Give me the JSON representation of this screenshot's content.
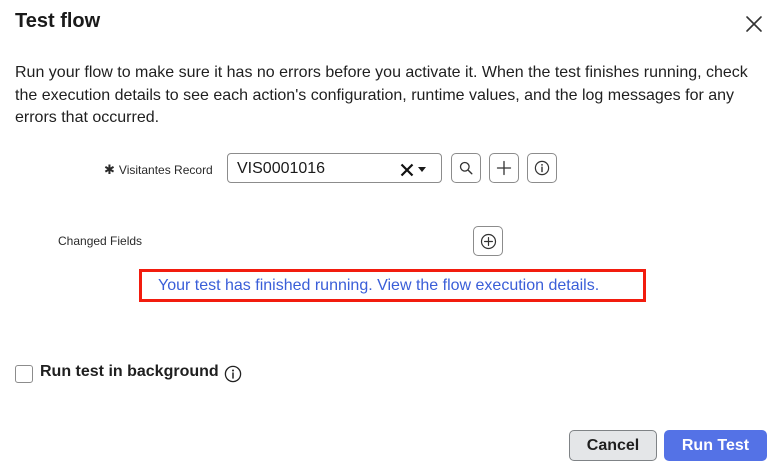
{
  "dialog": {
    "title": "Test flow",
    "description": "Run your flow to make sure it has no errors before you activate it. When the test finishes running, check the execution details to see each action's configuration, runtime values, and the log messages for any errors that occurred."
  },
  "record_field": {
    "required_marker": "✱",
    "label": "Visitantes Record",
    "value": "VIS0001016"
  },
  "changed_fields": {
    "label": "Changed Fields"
  },
  "result": {
    "message": "Your test has finished running. View the flow execution details."
  },
  "background": {
    "label": "Run test in background",
    "checked": false
  },
  "buttons": {
    "cancel": "Cancel",
    "run": "Run Test"
  },
  "colors": {
    "link": "#3a5ed8",
    "highlight_border": "#f21c0e",
    "primary_button": "#5472e6"
  },
  "icons": {
    "close": "close-icon",
    "clear": "clear-x-icon",
    "caret": "caret-down-icon",
    "lookup": "search-icon",
    "add": "plus-icon",
    "preview": "info-icon",
    "add_field": "plus-circle-icon",
    "background_info": "info-icon"
  }
}
